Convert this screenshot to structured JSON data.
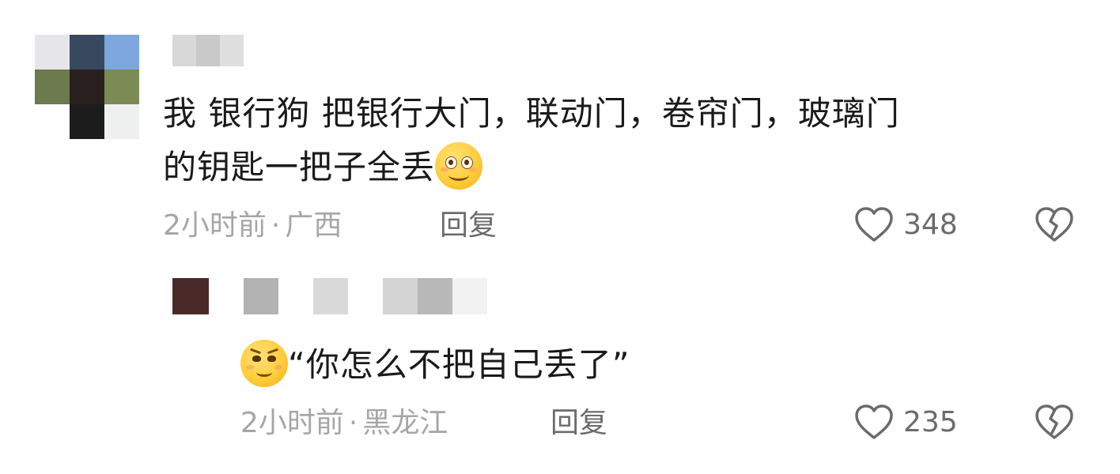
{
  "comments": [
    {
      "text_line1": "我  银行狗  把银行大门，联动门，卷帘门，玻璃门",
      "text_line2": "的钥匙一把子全丢",
      "emoji": "blushing-smile-emoji",
      "time": "2小时前",
      "location": "广西",
      "reply_label": "回复",
      "likes": "348"
    },
    {
      "quote_open": "“",
      "text_line1": "你怎么不把自己丢了",
      "quote_close": "”",
      "emoji": "smirk-emoji",
      "time": "2小时前",
      "location": "黑龙江",
      "reply_label": "回复",
      "likes": "235"
    }
  ],
  "separator": "·",
  "colors": {
    "text": "#1a1a1a",
    "meta": "#a6a6a6",
    "action": "#6b6b6b"
  },
  "icons": {
    "like": "heart-outline-icon",
    "dislike": "broken-heart-icon"
  },
  "pixelated": {
    "avatar_main": [
      "#e6e6ea",
      "#38495f",
      "#7ea6df",
      "#6c7a4e",
      "#2a1f1f",
      "#7b8b56",
      "#ffffff",
      "#1c1c1c",
      "#eef0f0"
    ],
    "username_main": [
      "#d8d8d8",
      "#c9c9c9",
      "#dedede"
    ],
    "avatar_reply": [
      "#4a2a28"
    ],
    "username_reply": [
      "#b3b3b3",
      "#ffffff",
      "#d9d9d9",
      "#ffffff",
      "#d4d4d4",
      "#b9b9b9",
      "#f2f2f2"
    ]
  }
}
